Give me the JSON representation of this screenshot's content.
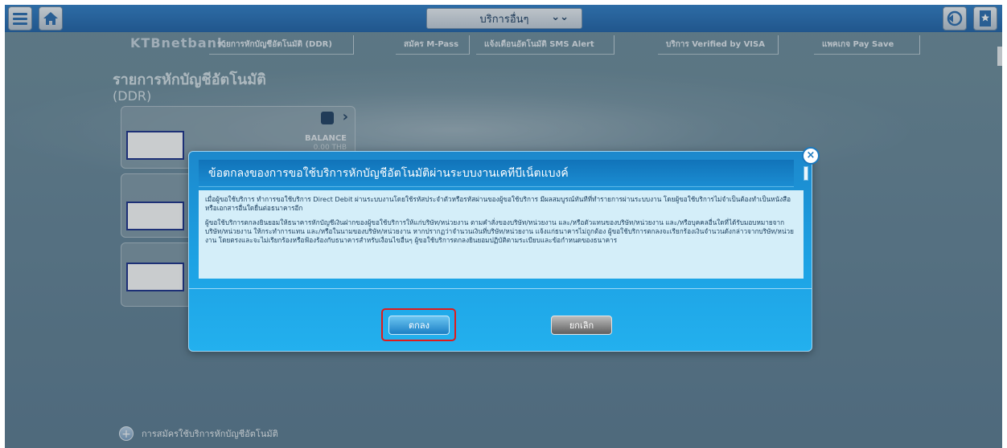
{
  "header": {
    "dropdown_label": "บริการอื่นๆ",
    "icons": {
      "menu": "hamburger-icon",
      "home": "home-icon",
      "back": "back-arrow-icon",
      "bookmark": "bookmark-icon"
    }
  },
  "tabs": [
    "รายการหักบัญชีอัตโนมัติ (DDR)",
    "สมัคร M-Pass",
    "แจ้งเตือนอัตโนมัติ SMS Alert",
    "บริการ Verified by VISA",
    "แพคเกจ Pay Save"
  ],
  "page": {
    "section_title": "รายการหักบัญชีอัตโนมัติ",
    "section_subtitle": "(DDR)",
    "card": {
      "balance_label": "BALANCE",
      "balance_amount": "0.00 THB"
    },
    "register_link": "การสมัครใช้บริการหักบัญชีอัตโนมัติ"
  },
  "modal": {
    "title": "ข้อตกลงของการขอใช้บริการหักบัญชีอัตโนมัติผ่านระบบงานเคทีบีเน็ตแบงค์",
    "paragraph1": "เมื่อผู้ขอใช้บริการ ทำการขอใช้บริการ Direct Debit ผ่านระบบงานโดยใช้รหัสประจำตัวหรือรหัสผ่านของผู้ขอใช้บริการ มีผลสมบูรณ์ทันทีที่ทำรายการผ่านระบบงาน โดยผู้ขอใช้บริการไม่จำเป็นต้องทำเป็นหนังสือหรือเอกสารอื่นใดยื่นต่อธนาคารอีก",
    "paragraph2": "ผู้ขอใช้บริการตกลงยินยอมให้ธนาคารหักบัญชีเงินฝากของผู้ขอใช้บริการให้แก่บริษัท/หน่วยงาน ตามคำสั่งของบริษัท/หน่วยงาน และ/หรือตัวแทนของบริษัท/หน่วยงาน และ/หรือบุคคลอื่นใดที่ได้รับมอบหมายจากบริษัท/หน่วยงาน ให้กระทำการแทน และ/หรือในนามของบริษัท/หน่วยงาน หากปรากฏว่าจำนวนเงินที่บริษัท/หน่วยงาน แจ้งแก่ธนาคารไม่ถูกต้อง ผู้ขอใช้บริการตกลงจะเรียกร้องเงินจำนวนดังกล่าวจากบริษัท/หน่วยงาน โดยตรงและจะไม่เรียกร้องหรือฟ้องร้องกับธนาคารสำหรับเงื่อนไขอื่นๆ ผู้ขอใช้บริการตกลงยินยอมปฏิบัติตามระเบียบและข้อกำหนดของธนาคาร",
    "ok_label": "ตกลง",
    "cancel_label": "ยกเลิก",
    "close_symbol": "×"
  },
  "colors": {
    "highlight": "#e01b1b",
    "modal_blue": "#1da2e4"
  }
}
